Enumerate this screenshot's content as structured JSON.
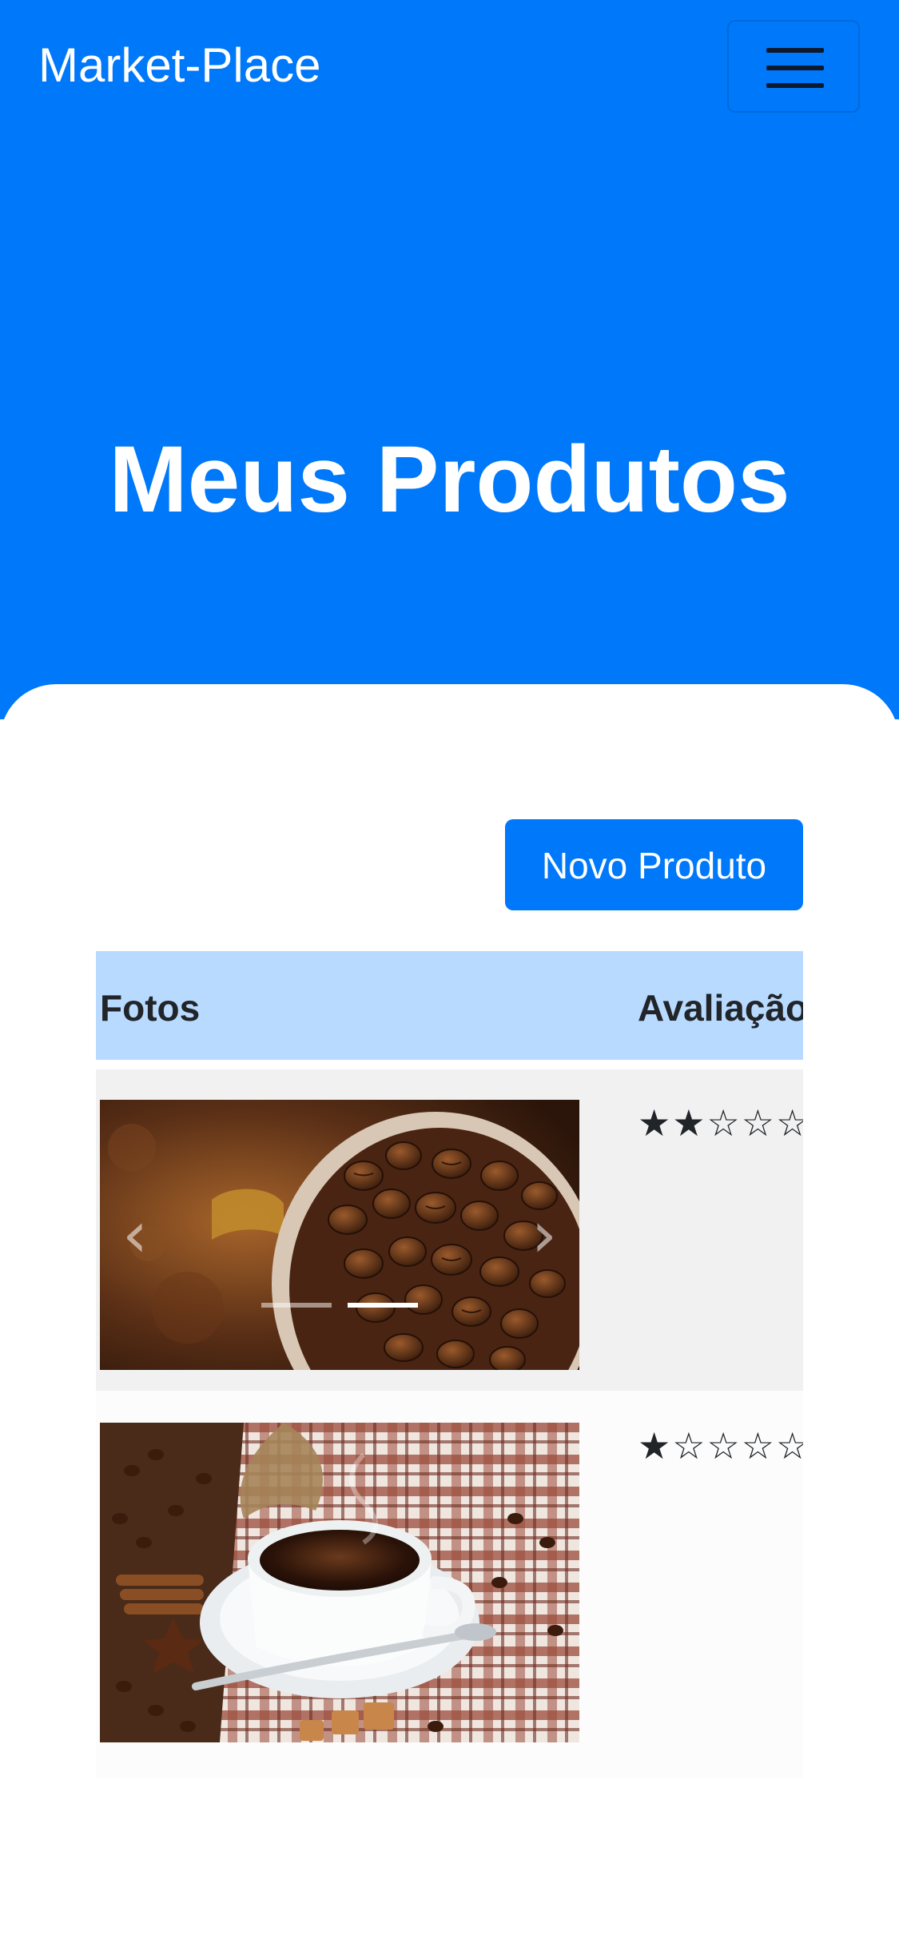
{
  "navbar": {
    "brand": "Market-Place",
    "toggler_icon": "hamburger-icon"
  },
  "hero": {
    "title": "Meus Produtos"
  },
  "actions": {
    "new_product_label": "Novo Produto"
  },
  "table": {
    "headers": {
      "photos": "Fotos",
      "rating": "Avaliação"
    },
    "rows": [
      {
        "photo": "coffee-beans-in-cup-photo",
        "rating_text": "★★☆☆☆",
        "stars": 2,
        "max_stars": 5,
        "carousel": {
          "slides": 2,
          "active_slide": 2
        }
      },
      {
        "photo": "cup-of-coffee-photo",
        "rating_text": "★☆☆☆☆",
        "stars": 1,
        "max_stars": 5
      }
    ]
  },
  "colors": {
    "primary": "#0078fa",
    "table_header": "#b8daff",
    "row_odd": "#f1f1f1",
    "row_even": "#fcfcfc"
  }
}
